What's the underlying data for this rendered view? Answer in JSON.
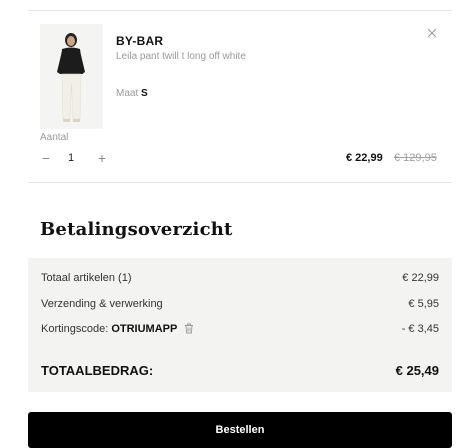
{
  "cart_item": {
    "brand": "BY-BAR",
    "name": "Leila pant twill t long off white",
    "size_label": "Maat",
    "size_value": "S",
    "quantity_label": "Aantal",
    "quantity": "1",
    "minus_symbol": "−",
    "plus_symbol": "+",
    "price_current": "€ 22,99",
    "price_original": "€ 129,95",
    "remove_icon": "close-icon"
  },
  "summary": {
    "title": "Betalingsoverzicht",
    "rows": [
      {
        "label": "Totaal artikelen (1)",
        "value": "€ 22,99"
      },
      {
        "label": "Verzending & verwerking",
        "value": "€ 5,95"
      },
      {
        "label_prefix": "Kortingscode:",
        "code": "OTRIUMAPP",
        "value": "- € 3,45",
        "icon": "trash-icon"
      }
    ],
    "total_label": "TOTAALBEDRAG:",
    "total_value": "€ 25,49"
  },
  "actions": {
    "order_label": "Bestellen"
  },
  "colors": {
    "button_bg": "#000000",
    "summary_bg": "#f3f3f1",
    "muted_text": "#9a9a9a"
  }
}
